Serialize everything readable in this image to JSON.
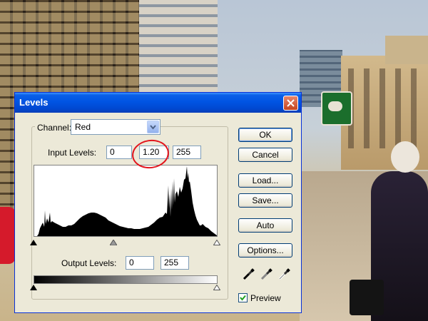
{
  "dialog": {
    "title": "Levels",
    "channel_label": "Channel:",
    "channel_value": "Red",
    "input_levels_label": "Input Levels:",
    "input_black": "0",
    "input_gamma": "1.20",
    "input_white": "255",
    "output_levels_label": "Output Levels:",
    "output_black": "0",
    "output_white": "255",
    "preview_label": "Preview",
    "preview_checked": true
  },
  "buttons": {
    "ok": "OK",
    "cancel": "Cancel",
    "load": "Load...",
    "save": "Save...",
    "auto": "Auto",
    "options": "Options..."
  },
  "icons": {
    "close": "close-icon",
    "dropdown": "chevron-down-icon",
    "black_eyedropper": "black-eyedropper-icon",
    "gray_eyedropper": "gray-eyedropper-icon",
    "white_eyedropper": "white-eyedropper-icon"
  },
  "colors": {
    "title_bar": "#0054e3",
    "dialog_bg": "#ece9d8",
    "annotation": "#e2141c"
  }
}
